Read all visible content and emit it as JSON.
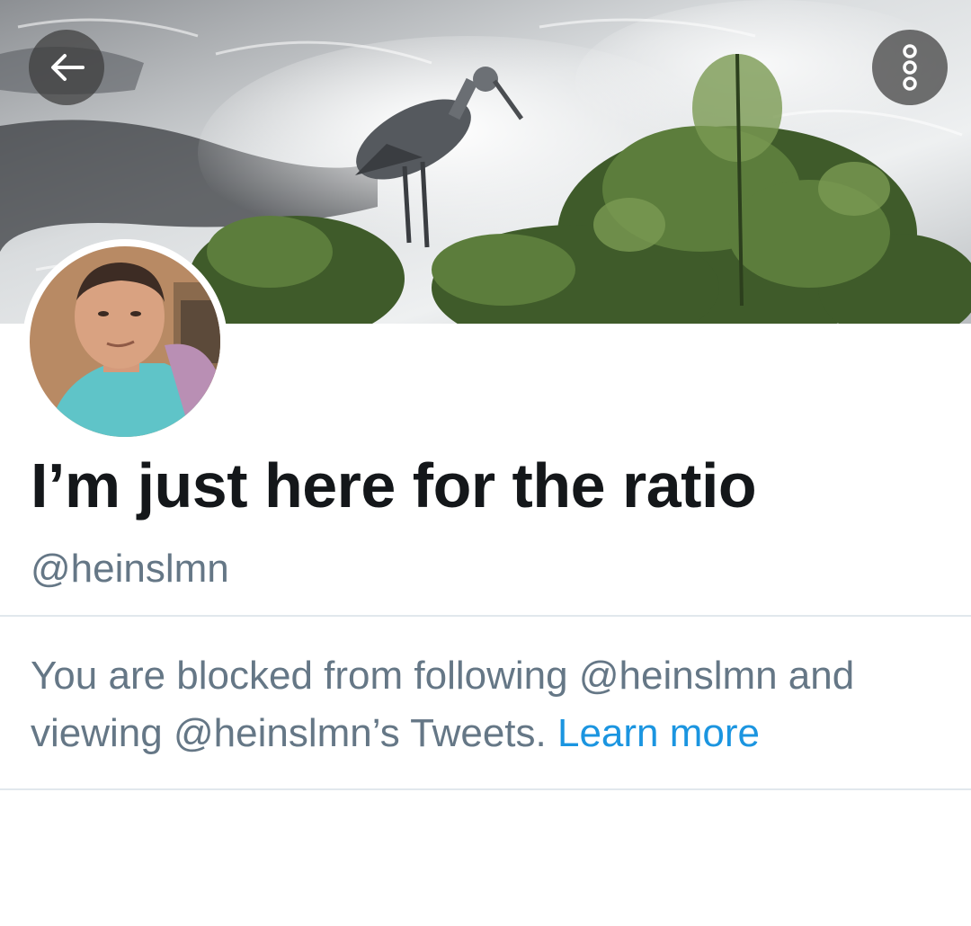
{
  "header": {
    "back_icon": "arrow-left-icon",
    "more_icon": "vertical-dots-icon"
  },
  "profile": {
    "display_name": "I’m just here for the ratio",
    "handle": "@heinslmn"
  },
  "blocked_notice": {
    "text": "You are blocked from following @heinslmn and viewing @heinslmn’s Tweets. ",
    "learn_more_label": "Learn more"
  },
  "colors": {
    "text_primary": "#14171a",
    "text_secondary": "#657786",
    "link": "#1b95e0",
    "divider": "#e1e8ed"
  }
}
